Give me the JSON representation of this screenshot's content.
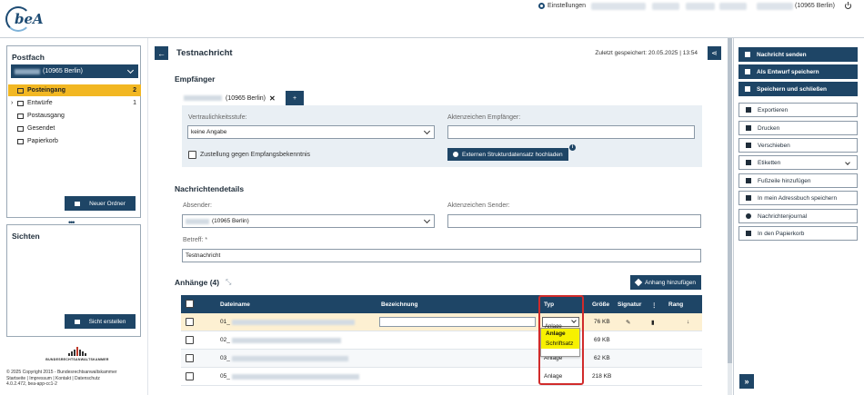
{
  "topbar": {
    "settings": "Einstellungen",
    "user": "(10965 Berlin)"
  },
  "sidebar": {
    "title": "Postfach",
    "mailbox": "(10965 Berlin)",
    "folders": [
      {
        "label": "Posteingang",
        "count": "2",
        "icon": "inbox-icon"
      },
      {
        "label": "Entwürfe",
        "count": "1",
        "icon": "edit-icon"
      },
      {
        "label": "Postausgang",
        "count": "",
        "icon": "outbox-icon"
      },
      {
        "label": "Gesendet",
        "count": "",
        "icon": "send-icon"
      },
      {
        "label": "Papierkorb",
        "count": "",
        "icon": "trash-icon"
      }
    ],
    "new_folder": "Neuer Ordner",
    "views_title": "Sichten",
    "create_view": "Sicht erstellen"
  },
  "brand": {
    "name": "BUNDESRECHTSANWALTSKAMMER",
    "footer1": "© 2025 Copyright 2015 - Bundesrechtsanwaltskammer",
    "footer2": "Startseite | Impressum | Kontakt | Datenschutz",
    "footer3": "4.0.2.472, bea-app-cc1-2"
  },
  "message": {
    "title": "Testnachricht",
    "saved": "Zuletzt gespeichert: 20.05.2025 | 13:54",
    "recipients_title": "Empfänger",
    "recipient": "(10965 Berlin)",
    "plus": "+",
    "confidentiality_label": "Vertraulichkeitsstufe:",
    "confidentiality_value": "keine Angabe",
    "ref_recipient_label": "Aktenzeichen Empfänger:",
    "ack_label": "Zustellung gegen Empfangsbekenntnis",
    "upload_label": "Externen Strukturdatensatz hochladen",
    "details_title": "Nachrichtendetails",
    "sender_label": "Absender:",
    "sender_value": "(10965 Berlin)",
    "ref_sender_label": "Aktenzeichen Sender:",
    "subject_label": "Betreff: *",
    "subject_value": "Testnachricht"
  },
  "attachments": {
    "title": "Anhänge (4)",
    "add": "Anhang hinzufügen",
    "columns": {
      "file": "Dateiname",
      "desc": "Bezeichnung",
      "type": "Typ",
      "size": "Größe",
      "sig": "Signatur",
      "rank": "Rang"
    },
    "rows": [
      {
        "prefix": "01_",
        "type": "Anlage",
        "size": "76 KB"
      },
      {
        "prefix": "02_",
        "type": "",
        "size": "69 KB"
      },
      {
        "prefix": "03_",
        "type": "Anlage",
        "size": "62 KB"
      },
      {
        "prefix": "05_",
        "type": "Anlage",
        "size": "218 KB"
      }
    ],
    "dropdown_options": [
      "Anlage",
      "Schriftsatz"
    ]
  },
  "actions": [
    {
      "label": "Nachricht senden",
      "style": "dark",
      "icon": "send-icon"
    },
    {
      "label": "Als Entwurf speichern",
      "style": "dark",
      "icon": "save-icon"
    },
    {
      "label": "Speichern und schließen",
      "style": "dark",
      "icon": "save-close-icon"
    },
    {
      "label": "Exportieren",
      "style": "light",
      "icon": "download-icon"
    },
    {
      "label": "Drucken",
      "style": "light",
      "icon": "print-icon"
    },
    {
      "label": "Verschieben",
      "style": "light",
      "icon": "folder-icon"
    },
    {
      "label": "Etiketten",
      "style": "light",
      "icon": "tag-icon"
    },
    {
      "label": "Fußzeile hinzufügen",
      "style": "light",
      "icon": "file-icon"
    },
    {
      "label": "In mein Adressbuch speichern",
      "style": "light",
      "icon": "addressbook-icon"
    },
    {
      "label": "Nachrichtenjournal",
      "style": "light",
      "icon": "info-icon"
    },
    {
      "label": "In den Papierkorb",
      "style": "light",
      "icon": "trash-icon"
    }
  ],
  "colors": {
    "primary": "#1e4566",
    "accent": "#f2b722",
    "highlight": "#f7f100",
    "alert": "#d12b2b"
  }
}
